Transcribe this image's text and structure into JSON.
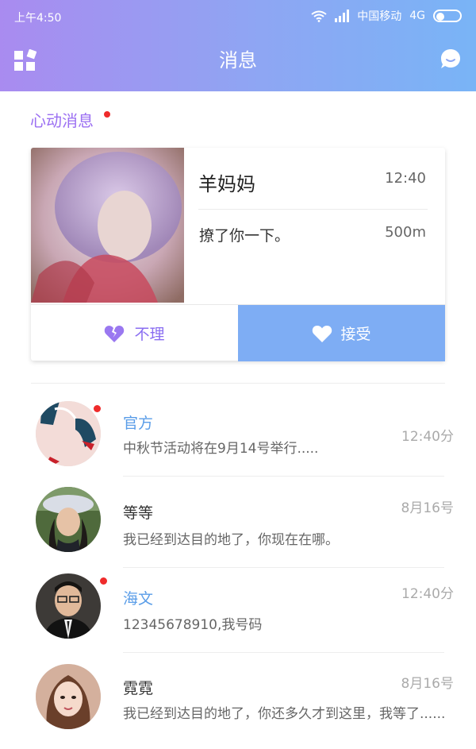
{
  "status_bar": {
    "time": "上午4:50",
    "carrier": "中国移动",
    "network": "4G"
  },
  "nav": {
    "title": "消息"
  },
  "section": {
    "title": "心动消息"
  },
  "like_card": {
    "name": "羊妈妈",
    "time": "12:40",
    "message": "撩了你一下。",
    "distance": "500m",
    "ignore_label": "不理",
    "accept_label": "接受"
  },
  "conversations": [
    {
      "name": "官方",
      "preview": "中秋节活动将在9月14号举行.....",
      "time": "12:40分",
      "unread": true,
      "highlight": true
    },
    {
      "name": "等等",
      "preview": "我已经到达目的地了，你现在在哪。",
      "time": "8月16号",
      "unread": false,
      "highlight": false
    },
    {
      "name": "海文",
      "preview": "12345678910,我号码",
      "time": "12:40分",
      "unread": true,
      "highlight": true
    },
    {
      "name": "霓霓",
      "preview": "我已经到达目的地了，你还多久才到这里，我等了......",
      "time": "8月16号",
      "unread": false,
      "highlight": false
    }
  ],
  "colors": {
    "header_gradient_start": "#a98bf0",
    "header_gradient_end": "#79b4f6",
    "accent_purple": "#9b6ff2",
    "accept_blue": "#7eadf4",
    "unread_red": "#ef2b2b",
    "name_blue": "#5a9de8"
  },
  "icons": {
    "grid": "apps-grid-icon",
    "chat": "chat-bubble-icon",
    "wifi": "wifi-icon",
    "signal": "signal-icon",
    "broken_heart": "broken-heart-icon",
    "heart": "heart-icon"
  }
}
